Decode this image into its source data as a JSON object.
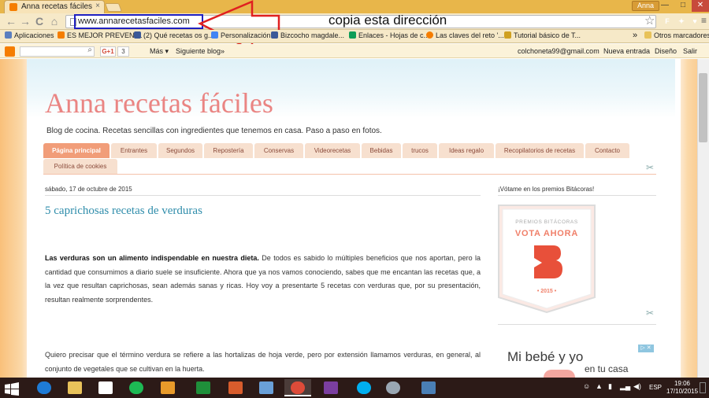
{
  "browser": {
    "tab_title": "Anna recetas fáciles",
    "tab_close": "×",
    "profile": "Anna",
    "window_controls": {
      "minimize": "—",
      "maximize": "□",
      "close": "✕"
    },
    "url": "www.annarecetasfaciles.com",
    "nav": {
      "back": "←",
      "forward": "→",
      "reload": "C",
      "home": "⌂"
    },
    "star": "☆",
    "extensions": [
      {
        "name": "flipboard",
        "label": "F",
        "color": "#e12828"
      },
      {
        "name": "flashy",
        "label": "✦",
        "color": "#1a1a1a"
      },
      {
        "name": "heart",
        "label": "♥",
        "color": "#2b6bd6"
      }
    ],
    "menu": "≡"
  },
  "annotation": {
    "text": "copia esta dirección",
    "arrow_color": "#e02020",
    "box_color": "#2020c0"
  },
  "bookmarks": {
    "items": [
      {
        "label": "Aplicaciones",
        "icon_color": "#5b7fbf"
      },
      {
        "label": "ES MEJOR PREVENI...",
        "icon_color": "#f57d00"
      },
      {
        "label": "(2) Qué recetas os g...",
        "icon_color": "#3b5998"
      },
      {
        "label": "Personalización",
        "icon_color": "#4285f4"
      },
      {
        "label": "Bizcocho magdale...",
        "icon_color": "#3b5998"
      },
      {
        "label": "Enlaces - Hojas de c...",
        "icon_color": "#0f9d58"
      },
      {
        "label": "Las claves del reto '...",
        "icon_color": "#f57d00"
      },
      {
        "label": "Tutorial básico de T...",
        "icon_color": "#d0a020"
      }
    ],
    "more": "»",
    "other": "Otros marcadores"
  },
  "blogger_nav": {
    "gplus": "G+1",
    "gcount": "3",
    "more": "Más ▾",
    "next_blog": "Siguiente blog»",
    "email": "colchoneta99@gmail.com",
    "new_entry": "Nueva entrada",
    "design": "Diseño",
    "logout": "Salir"
  },
  "blog": {
    "title": "Anna recetas fáciles",
    "description": "Blog de cocina. Recetas sencillas con ingredientes que tenemos en casa. Paso a paso en fotos.",
    "tabs": [
      "Página principal",
      "Entrantes",
      "Segundos",
      "Repostería",
      "Conservas",
      "Videorecetas",
      "Bebidas",
      "trucos",
      "Ideas regalo",
      "Recopilatorios de recetas",
      "Contacto",
      "Política de cookies"
    ]
  },
  "post": {
    "date": "sábado, 17 de octubre de 2015",
    "title": "5 caprichosas recetas de verduras",
    "intro_bold": "Las verduras son un alimento indispendable en nuestra dieta.",
    "intro_rest": " De todos es sabido lo múltiples beneficios que nos aportan, pero la cantidad que consumimos a diario suele se insuficiente. Ahora que ya nos vamos conociendo, sabes que me encantan las recetas que, a la vez que resultan caprichosas, sean además sanas y ricas. Hoy voy a presentarte 5 recetas con verduras que, por su presentación, resultan realmente sorprendentes.",
    "para2": "Quiero precisar que el término verdura se refiere a las hortalizas de hoja verde, pero por extensión llamamos verduras, en general, al conjunto de vegetales que se cultivan en la huerta."
  },
  "sidebar": {
    "title": "¡Vótame en los premios Bitácoras!",
    "badge_top": "PREMIOS BITÁCORAS",
    "badge_cta": "VOTA AHORA",
    "badge_year": "• 2015 •",
    "ad_line1": "Mi bebé y yo",
    "ad_line2": "en tu casa",
    "ad_close": "▷ ✕"
  },
  "taskbar": {
    "apps": [
      {
        "name": "internet-explorer",
        "color": "#1e7bd6"
      },
      {
        "name": "file-explorer",
        "color": "#e8c25a"
      },
      {
        "name": "home",
        "color": "#ffffff"
      },
      {
        "name": "spotify",
        "color": "#1db954"
      },
      {
        "name": "notebook",
        "color": "#e89a2a"
      },
      {
        "name": "excel",
        "color": "#1f8f3a"
      },
      {
        "name": "paint",
        "color": "#d85c2c"
      },
      {
        "name": "control-panel",
        "color": "#6aa0d8"
      },
      {
        "name": "chrome",
        "color": "#dd4b39"
      },
      {
        "name": "onenote",
        "color": "#7b3fa0"
      },
      {
        "name": "skype",
        "color": "#00aff0"
      },
      {
        "name": "settings",
        "color": "#9aa7b3"
      },
      {
        "name": "photos",
        "color": "#4a7fb5"
      }
    ],
    "language": "ESP",
    "time": "19:06",
    "date": "17/10/2015"
  }
}
